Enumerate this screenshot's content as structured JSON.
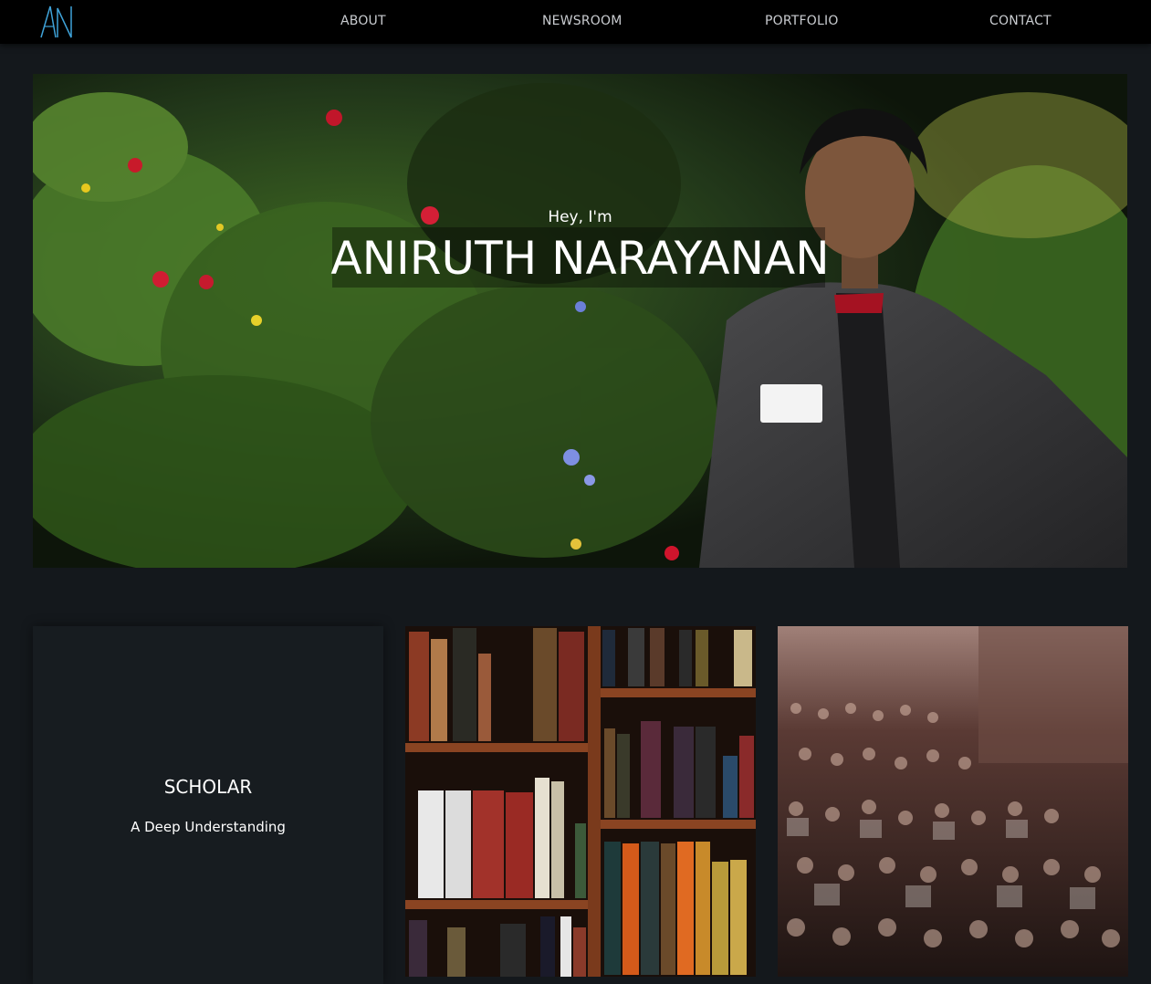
{
  "header": {
    "logo_text": "AN",
    "nav": [
      "ABOUT",
      "NEWSROOM",
      "PORTFOLIO",
      "CONTACT"
    ]
  },
  "hero": {
    "greeting": "Hey, I'm",
    "name": "ANIRUTH NARAYANAN"
  },
  "cards": {
    "scholar_title": "SCHOLAR",
    "scholar_subtitle": "A Deep Understanding"
  },
  "colors": {
    "background": "#14181c",
    "header": "#000000",
    "logo_accent": "#3fa3d9"
  },
  "icons": {
    "logo": "an-monogram-icon"
  }
}
